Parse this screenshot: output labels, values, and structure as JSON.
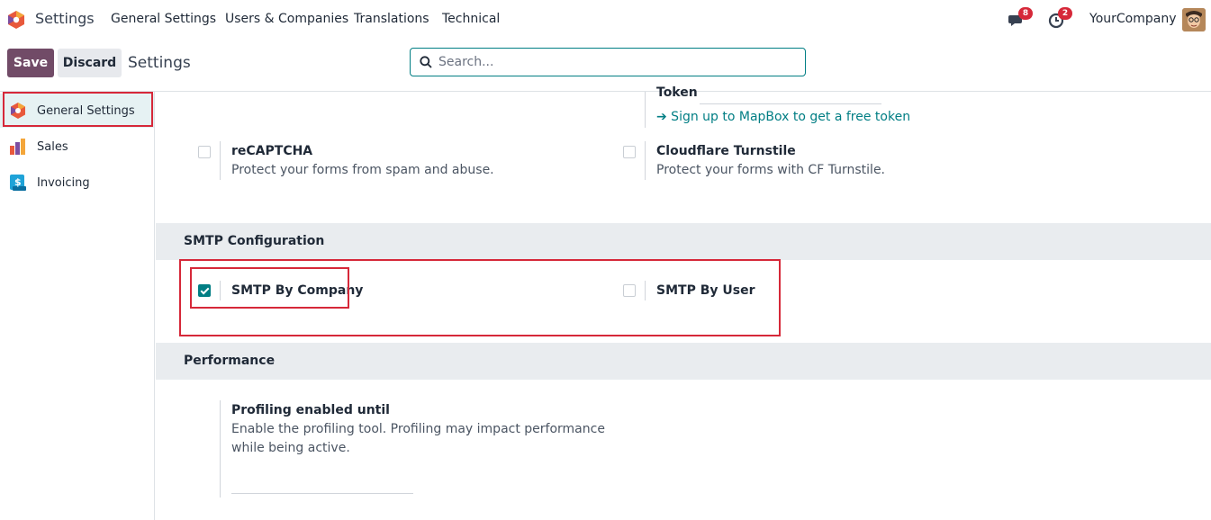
{
  "topnav": {
    "app_title": "Settings",
    "menu": [
      "General Settings",
      "Users & Companies",
      "Translations",
      "Technical"
    ],
    "messages_count": "8",
    "activities_count": "2",
    "company": "YourCompany"
  },
  "controlbar": {
    "save_label": "Save",
    "discard_label": "Discard",
    "title": "Settings",
    "search_placeholder": "Search..."
  },
  "sidebar": {
    "items": [
      {
        "label": "General Settings",
        "icon": "settings-app-icon",
        "active": true
      },
      {
        "label": "Sales",
        "icon": "sales-app-icon",
        "active": false
      },
      {
        "label": "Invoicing",
        "icon": "invoicing-app-icon",
        "active": false
      }
    ]
  },
  "main": {
    "token_label": "Token",
    "mapbox_link": "➔ Sign up to MapBox to get a free token",
    "recaptcha": {
      "title": "reCAPTCHA",
      "desc": "Protect your forms from spam and abuse.",
      "checked": false
    },
    "turnstile": {
      "title": "Cloudflare Turnstile",
      "desc": "Protect your forms with CF Turnstile.",
      "checked": false
    },
    "smtp_section": "SMTP Configuration",
    "smtp_company": {
      "title": "SMTP By Company",
      "checked": true
    },
    "smtp_user": {
      "title": "SMTP By User",
      "checked": false
    },
    "performance_section": "Performance",
    "profiling": {
      "title": "Profiling enabled until",
      "desc_line1": "Enable the profiling tool. Profiling may impact performance",
      "desc_line2": "while being active."
    }
  },
  "colors": {
    "brand": "#714b67",
    "accent": "#017e84",
    "highlight": "#d62839"
  }
}
